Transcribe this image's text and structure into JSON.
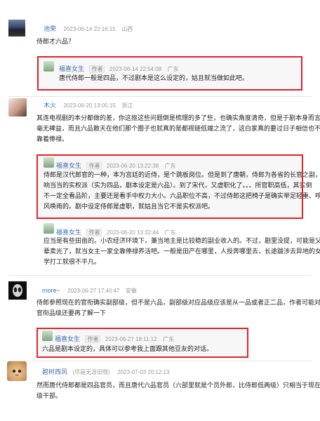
{
  "comments": [
    {
      "user": "池荣",
      "time": "2023-06-14 22:16:15",
      "location": "山西",
      "text": [
        "侍郎才六品？"
      ],
      "replies": [
        {
          "user": "福喜女生",
          "badge": "作者",
          "time": "2023-06-14 22:54:08",
          "location": "广东",
          "text": [
            "唐代侍郎一般是四品，不过剧本是这么设定的，姑且就当做如此吧。"
          ]
        }
      ]
    },
    {
      "user": "木火",
      "time": "2023-06-20 13:05:15",
      "location": "浙江",
      "text": [
        "其连电视剧的本分都做的差，你这抠这些问题倒是梳理的多了些，也确实角度清奇，但是于剧本身而言，",
        "毫无裨益，而且六品散天在他们那个圈子也就真的是都视链低端之流了，这白家真的要过日子相信也不光",
        "靠着俸禄。"
      ],
      "replies": [
        {
          "user": "福喜女生",
          "badge": "作者",
          "time": "2023-06-20 13:22:38",
          "location": "广东",
          "text": [
            "侍郎是汉代郎官的一种，本为宫廷的近侍，是个跳板岗位。但是到了唐朝，侍郎为各省的长官之副，",
            "响当当的实权派（实为四品，剧本设定是六品）。到了宋代，又虚职化了。。。所官职高低，其实倒",
            "不一定全看品阶，主要还是看手中权力大小。六品职位不高，不过侍郎这把椅子是确实举足轻重、呼",
            "风唤雨的。剧中设定侍郎是虚职，就姑且当它不是实权派吧。"
          ]
        },
        {
          "user": "福喜女生",
          "badge": "作者",
          "time": "2023-06-20 13:32:44",
          "location": "广东",
          "text": [
            "应当是有些田亩的。小农经济环境下，兼当地主是比较稳的副业收入的。不过，剧里没提，可能是父",
            "辈卖光了，就当女主一家全靠俸禄养活吧。一般是田产在哪里，人投奔哪里去，长途跋涉去异地的女",
            "学打工就很不平凡。"
          ]
        }
      ]
    },
    {
      "user": "more~",
      "time": "2023-06-27 17:40:47",
      "location": "安徽",
      "text": [
        "侍郎参照现在的官衔确实副部级，但不是六品，副部级对应品级应该是从一品或者正二品，作者可能对于",
        "官衔品级还要再了解一下"
      ],
      "replies": [
        {
          "user": "福喜女生",
          "badge": "作者",
          "time": "2023-06-27 18:11:12",
          "location": "广东",
          "text": [
            "六品是剧本设定的，具体可以参考我上面跟其他豆友的对话。"
          ]
        }
      ]
    },
    {
      "user": "碧树西风",
      "note": "(尽是无涯旧恨)",
      "time": "2023-07-03 20:12:13",
      "location": "",
      "text": [
        "然而唐代侍郎都是四品官员，而且唐代六品官员（六部里就是个员外郎，比侍郎低两级）只相当于现在的厅",
        "级干部。"
      ],
      "replies": []
    }
  ],
  "colors": {
    "name": "#3f6fb4",
    "highlight": "#e0242a",
    "meta": "#999999"
  }
}
